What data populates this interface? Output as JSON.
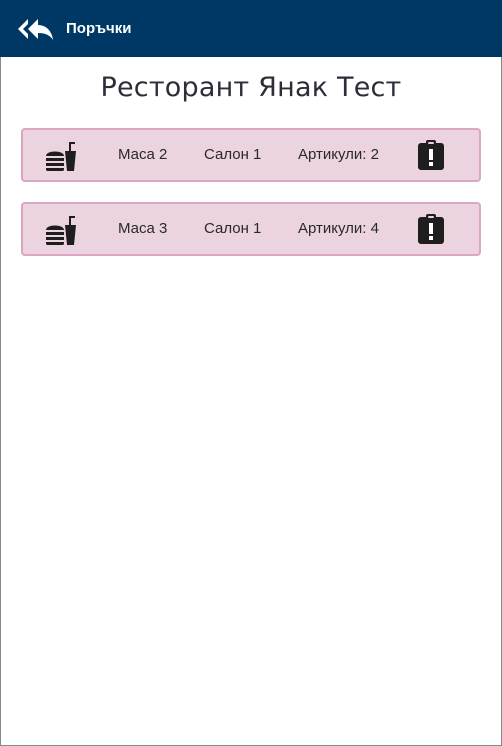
{
  "header": {
    "title": "Поръчки",
    "back_icon": "reply-all-icon",
    "background_color": "#003865"
  },
  "restaurant": {
    "name": "Ресторант Янак Тест"
  },
  "orders": [
    {
      "table": "Маса 2",
      "salon": "Салон 1",
      "items": "Артикули: 2",
      "icon": "fastfood-icon",
      "status_icon": "clipboard-alert-icon"
    },
    {
      "table": "Маса 3",
      "salon": "Салон 1",
      "items": "Артикули: 4",
      "icon": "fastfood-icon",
      "status_icon": "clipboard-alert-icon"
    }
  ],
  "colors": {
    "row_background": "#ecd3e0",
    "row_border": "#dba6c2"
  }
}
